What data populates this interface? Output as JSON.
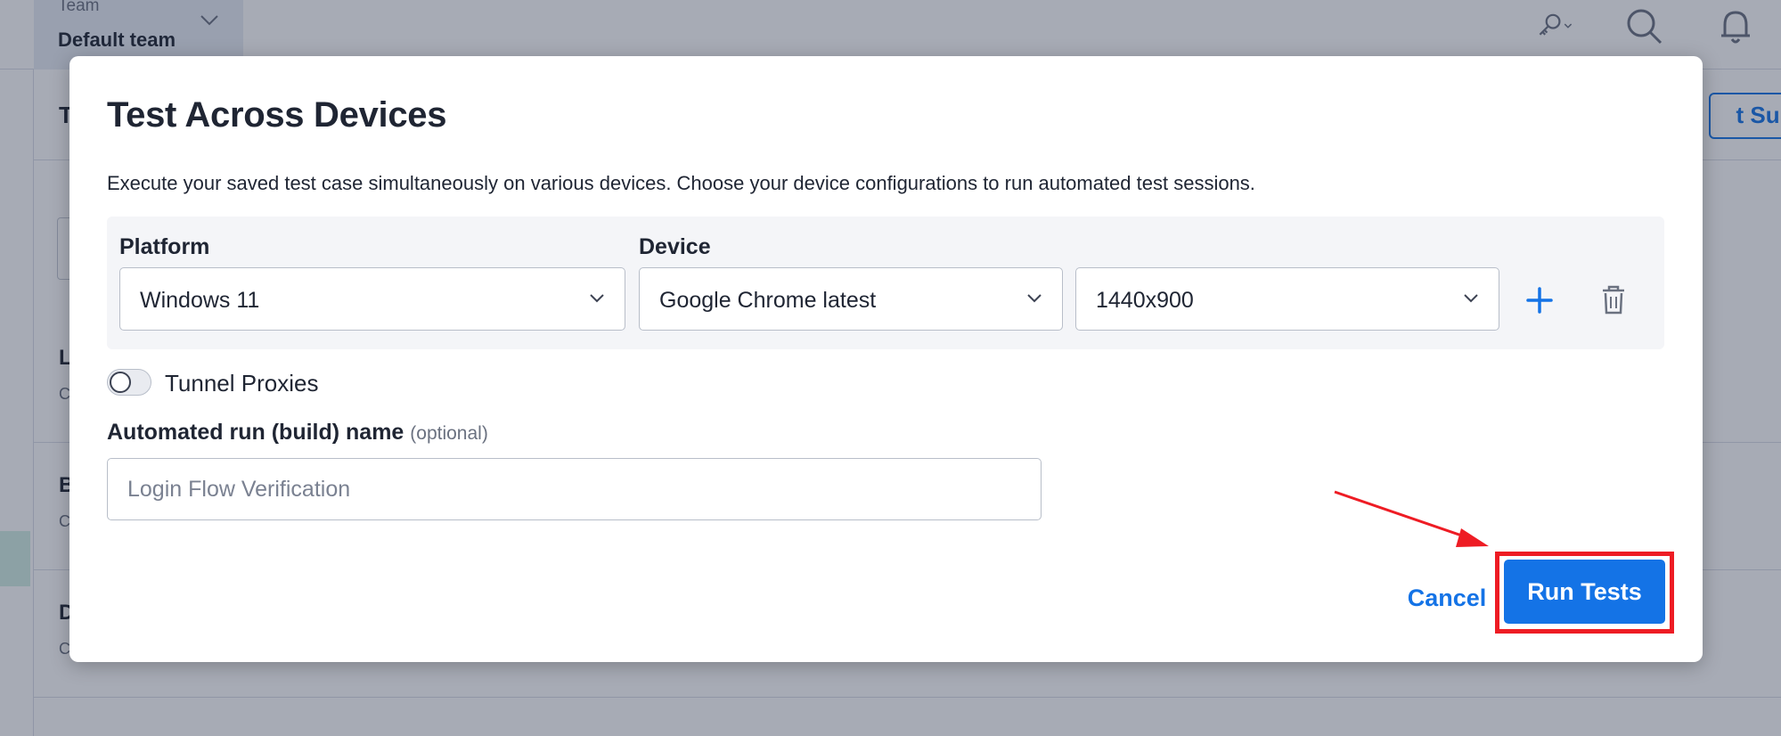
{
  "background": {
    "team_label": "Team",
    "team_name": "Default team",
    "title_initial": "T",
    "suite_button": "t Suite",
    "rows": [
      {
        "title": "L",
        "sub": "C"
      },
      {
        "title": "B",
        "sub": "C"
      },
      {
        "title": "D",
        "sub": "C"
      }
    ]
  },
  "modal": {
    "title": "Test Across Devices",
    "description": "Execute your saved test case simultaneously on various devices. Choose your device configurations to run automated test sessions.",
    "config": {
      "platform_label": "Platform",
      "device_label": "Device",
      "platform_value": "Windows 11",
      "device_value": "Google Chrome latest",
      "resolution_value": "1440x900"
    },
    "tunnel_label": "Tunnel Proxies",
    "tunnel_enabled": false,
    "build_name_label": "Automated run (build) name",
    "build_name_optional": "(optional)",
    "build_name_placeholder": "Login Flow Verification",
    "build_name_value": "",
    "cancel_label": "Cancel",
    "run_label": "Run Tests"
  },
  "colors": {
    "accent": "#1473e6",
    "annotation": "#ee1c24"
  },
  "icons": {
    "key": "key-icon",
    "search": "search-icon",
    "bell": "bell-icon",
    "add": "plus-icon",
    "delete": "trash-icon",
    "dropdown": "chevron-down-icon"
  }
}
